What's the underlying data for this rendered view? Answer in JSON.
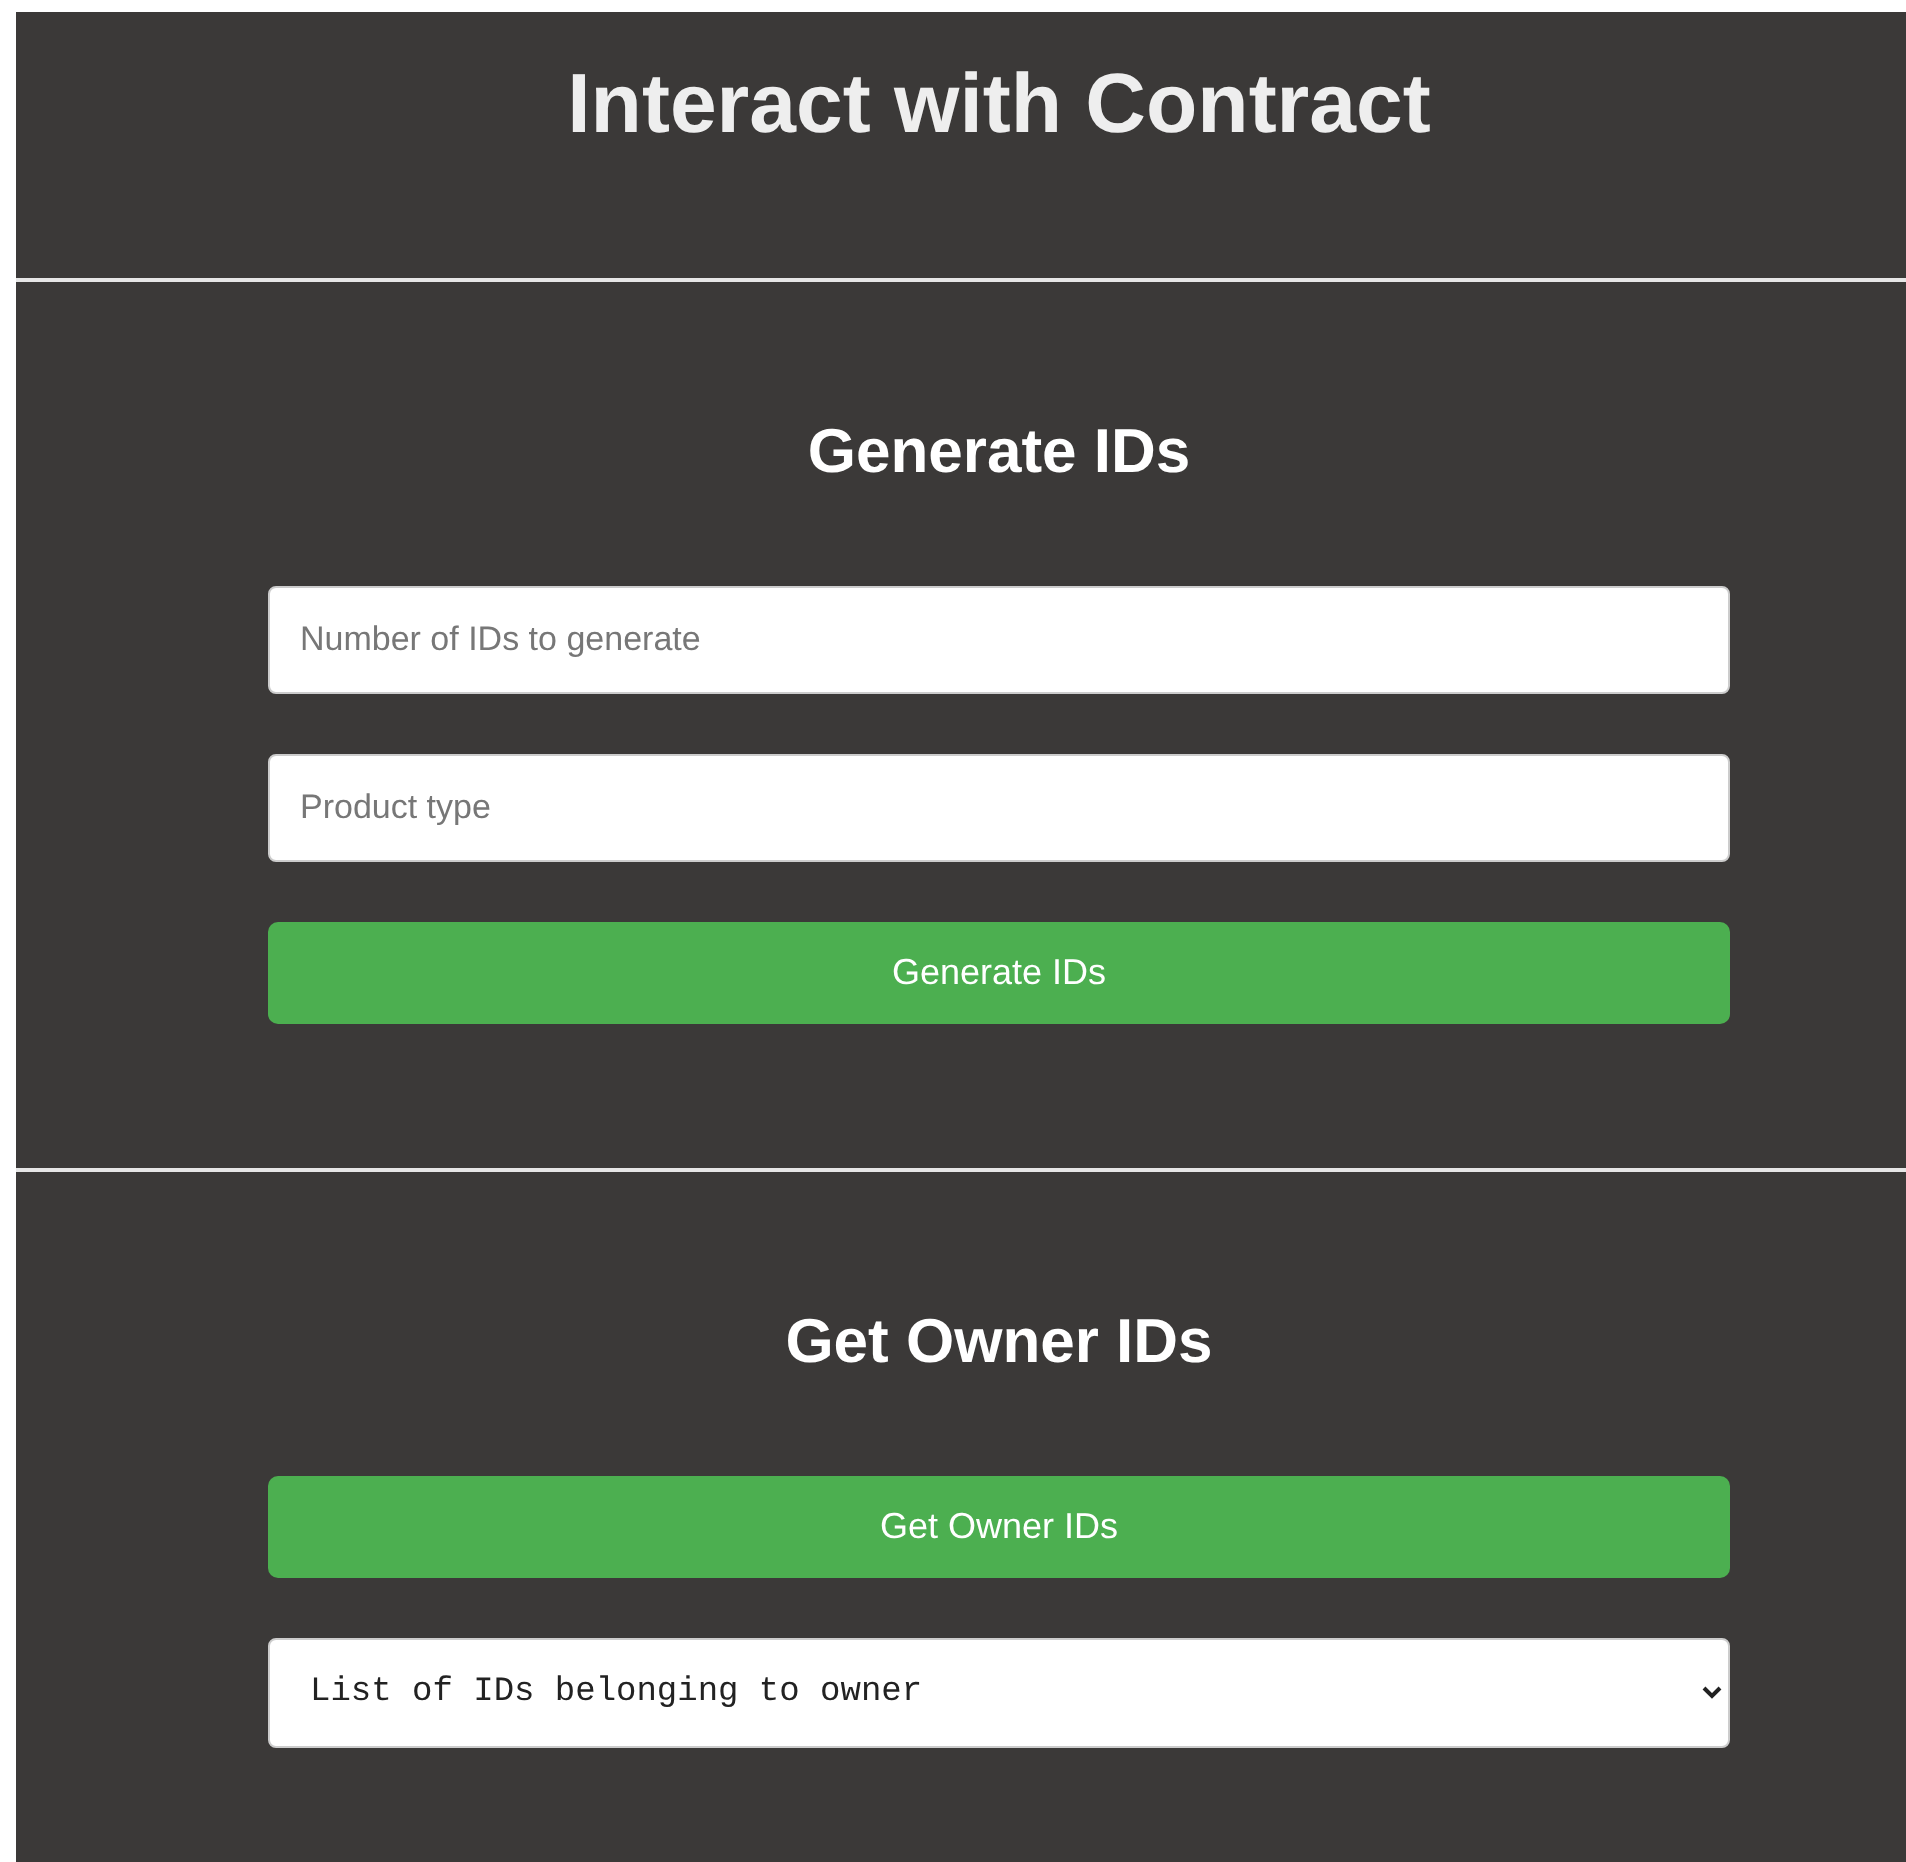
{
  "title": "Interact with Contract",
  "sections": [
    {
      "heading": "Generate IDs",
      "items": [
        {
          "kind": "input",
          "placeholder": "Number of IDs to generate"
        },
        {
          "kind": "input",
          "placeholder": "Product type"
        },
        {
          "kind": "button",
          "label": "Generate IDs"
        }
      ]
    },
    {
      "heading": "Get Owner IDs",
      "items": [
        {
          "kind": "button",
          "label": "Get Owner IDs"
        },
        {
          "kind": "select",
          "value": "List of IDs belonging to owner"
        }
      ]
    }
  ]
}
